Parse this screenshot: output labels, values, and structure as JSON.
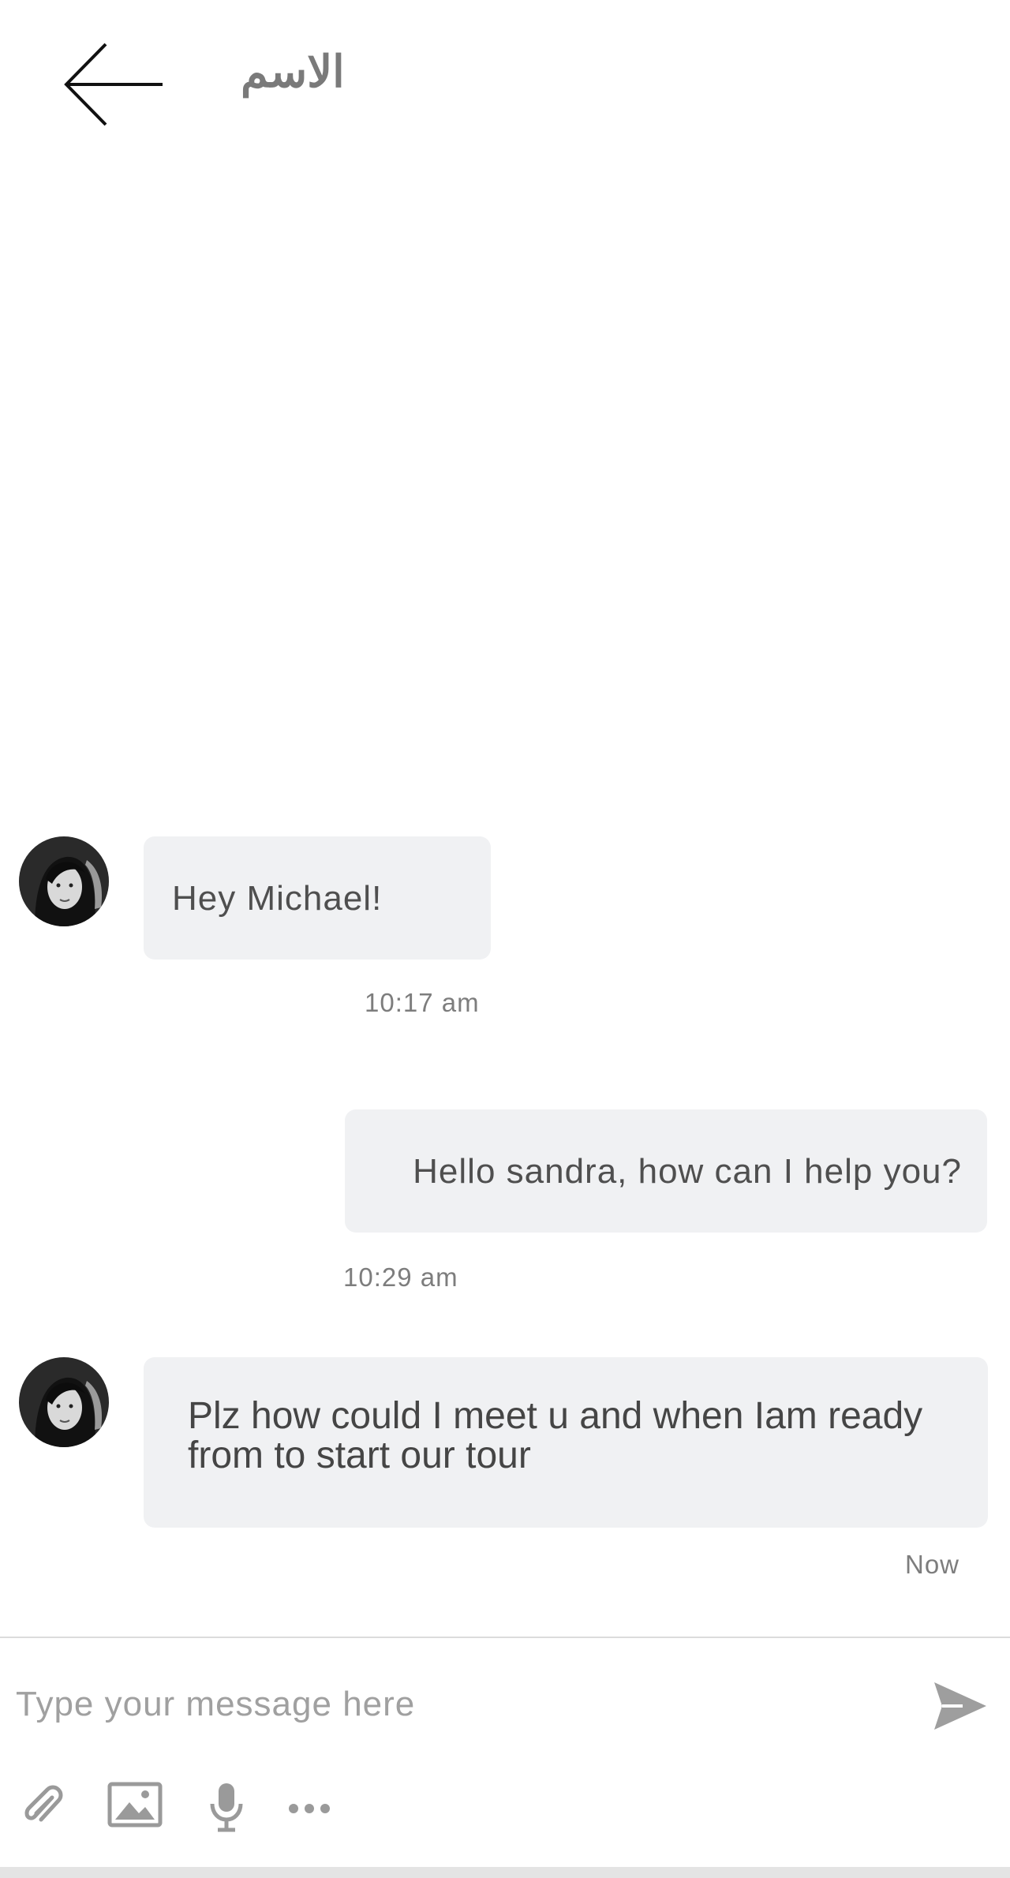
{
  "header": {
    "title": "الاسم",
    "back_icon": "arrow-left-icon"
  },
  "messages": [
    {
      "sender": "incoming",
      "text": "Hey Michael!",
      "time": "10:17 am"
    },
    {
      "sender": "outgoing",
      "text": "Hello sandra, how can I help you?",
      "time": "10:29 am"
    },
    {
      "sender": "incoming",
      "text": "Plz how could I meet u and when Iam ready from to start our tour",
      "time": "Now"
    }
  ],
  "composer": {
    "placeholder": "Type your message here",
    "send_icon": "send-icon",
    "tools": [
      "paperclip-icon",
      "image-icon",
      "microphone-icon",
      "more-icon"
    ]
  },
  "colors": {
    "bubble": "#f0f1f3",
    "text": "#4f4f4f",
    "time": "#7d7d7d",
    "title": "#7a7a7a",
    "placeholder": "#a0a0a0"
  }
}
